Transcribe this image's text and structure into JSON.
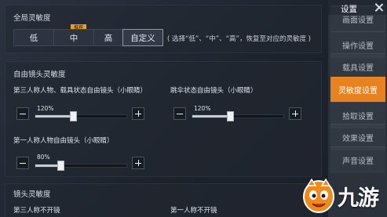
{
  "global": {
    "title": "全局灵敏度",
    "options": [
      "低",
      "中",
      "高",
      "自定义"
    ],
    "selected": "自定义",
    "recommended_badge": "推荐",
    "hint": "( 选择“低”、“中”、“高”，恢复至对应的灵敏度 )"
  },
  "free_look": {
    "title": "自由镜头灵敏度",
    "sliders": [
      {
        "label": "第三人称人物、载具状态自由镜头（小眼睛）",
        "value": 120,
        "value_text": "120%",
        "ratio": 0.4
      },
      {
        "label": "跳伞状态自由镜头（小眼睛）",
        "value": 120,
        "value_text": "120%",
        "ratio": 0.4
      },
      {
        "label": "第一人称人物自由镜头（小眼睛）",
        "value": 80,
        "value_text": "80%",
        "ratio": 0.27
      }
    ]
  },
  "camera": {
    "title": "镜头灵敏度",
    "labels": [
      "第三人称不开镜",
      "第一人称不开镜"
    ]
  },
  "sidebar": {
    "title": "设置",
    "items": [
      {
        "label": "画面设置",
        "active": false
      },
      {
        "label": "操作设置",
        "active": false
      },
      {
        "label": "载具设置",
        "active": false
      },
      {
        "label": "灵敏度设置",
        "active": true
      },
      {
        "label": "拾取设置",
        "active": false
      },
      {
        "label": "效果设置",
        "active": false
      },
      {
        "label": "声音设置",
        "active": false
      }
    ]
  },
  "watermark": {
    "text": "九游"
  },
  "colors": {
    "accent": "#e8821e",
    "badge": "#e8a020",
    "background": "#1e242d"
  }
}
